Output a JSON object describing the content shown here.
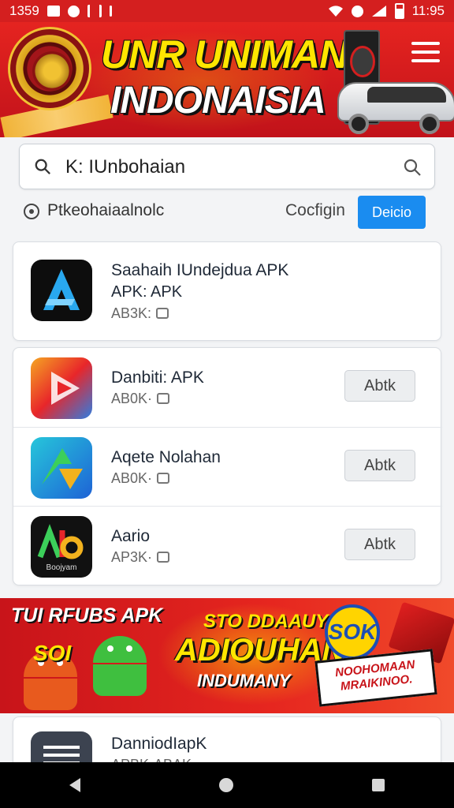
{
  "status_bar": {
    "left_time": "1359",
    "right_time": "11:95",
    "icons": [
      "image-icon",
      "notification-icon",
      "signal-icon",
      "wifi-icon",
      "alarm-icon",
      "signal-bars-icon",
      "battery-icon"
    ]
  },
  "header": {
    "title_line1": "UNR UNIMAN",
    "title_line2": "INDONAISIA",
    "menu_icon": "hamburger-menu-icon",
    "colors": {
      "background": "#d41f1f",
      "title_yellow": "#ffe600",
      "title_white": "#ffffff"
    }
  },
  "search": {
    "value": "K: IUnbohaian",
    "left_icon": "search-icon",
    "right_icon": "search-icon"
  },
  "filter": {
    "radio_label": "Ptkeohaiaalnolc",
    "config_label": "Cocfigin",
    "detail_button": "Deicio",
    "accent": "#1a8cf0"
  },
  "featured_app": {
    "name": "Saahaih IUndejdua APK",
    "subtitle": "APK: APK",
    "meta": "AB3K:",
    "icon": "app-logo-icon"
  },
  "apps": [
    {
      "name": "Danbiti: APK",
      "meta": "AB0K·",
      "button": "Abtk",
      "icon": "play-logo-icon"
    },
    {
      "name": "Aqete Nolahan",
      "meta": "AB0K·",
      "button": "Abtk",
      "icon": "arrow-logo-icon"
    },
    {
      "name": "Aario",
      "meta": "AP3K·",
      "button": "Abtk",
      "icon": "ab-logo-icon",
      "icon_caption": "Boojyam"
    }
  ],
  "promo": {
    "line_top_left": "TUI RFUBS APK",
    "sale_text": "SOI",
    "line_small": "STO DDAAUY",
    "line_big": "ADIOUHAN",
    "line_sub": "INDUMANY",
    "badge": "SOK",
    "tag": "NOOHOMAAN MRAIKINOO."
  },
  "last_app": {
    "name": "DanniodIapK",
    "meta": "APBK·ABAK",
    "icon": "document-app-icon"
  },
  "nav_bar": {
    "icons": [
      "back-icon",
      "home-icon",
      "recent-apps-icon"
    ]
  }
}
